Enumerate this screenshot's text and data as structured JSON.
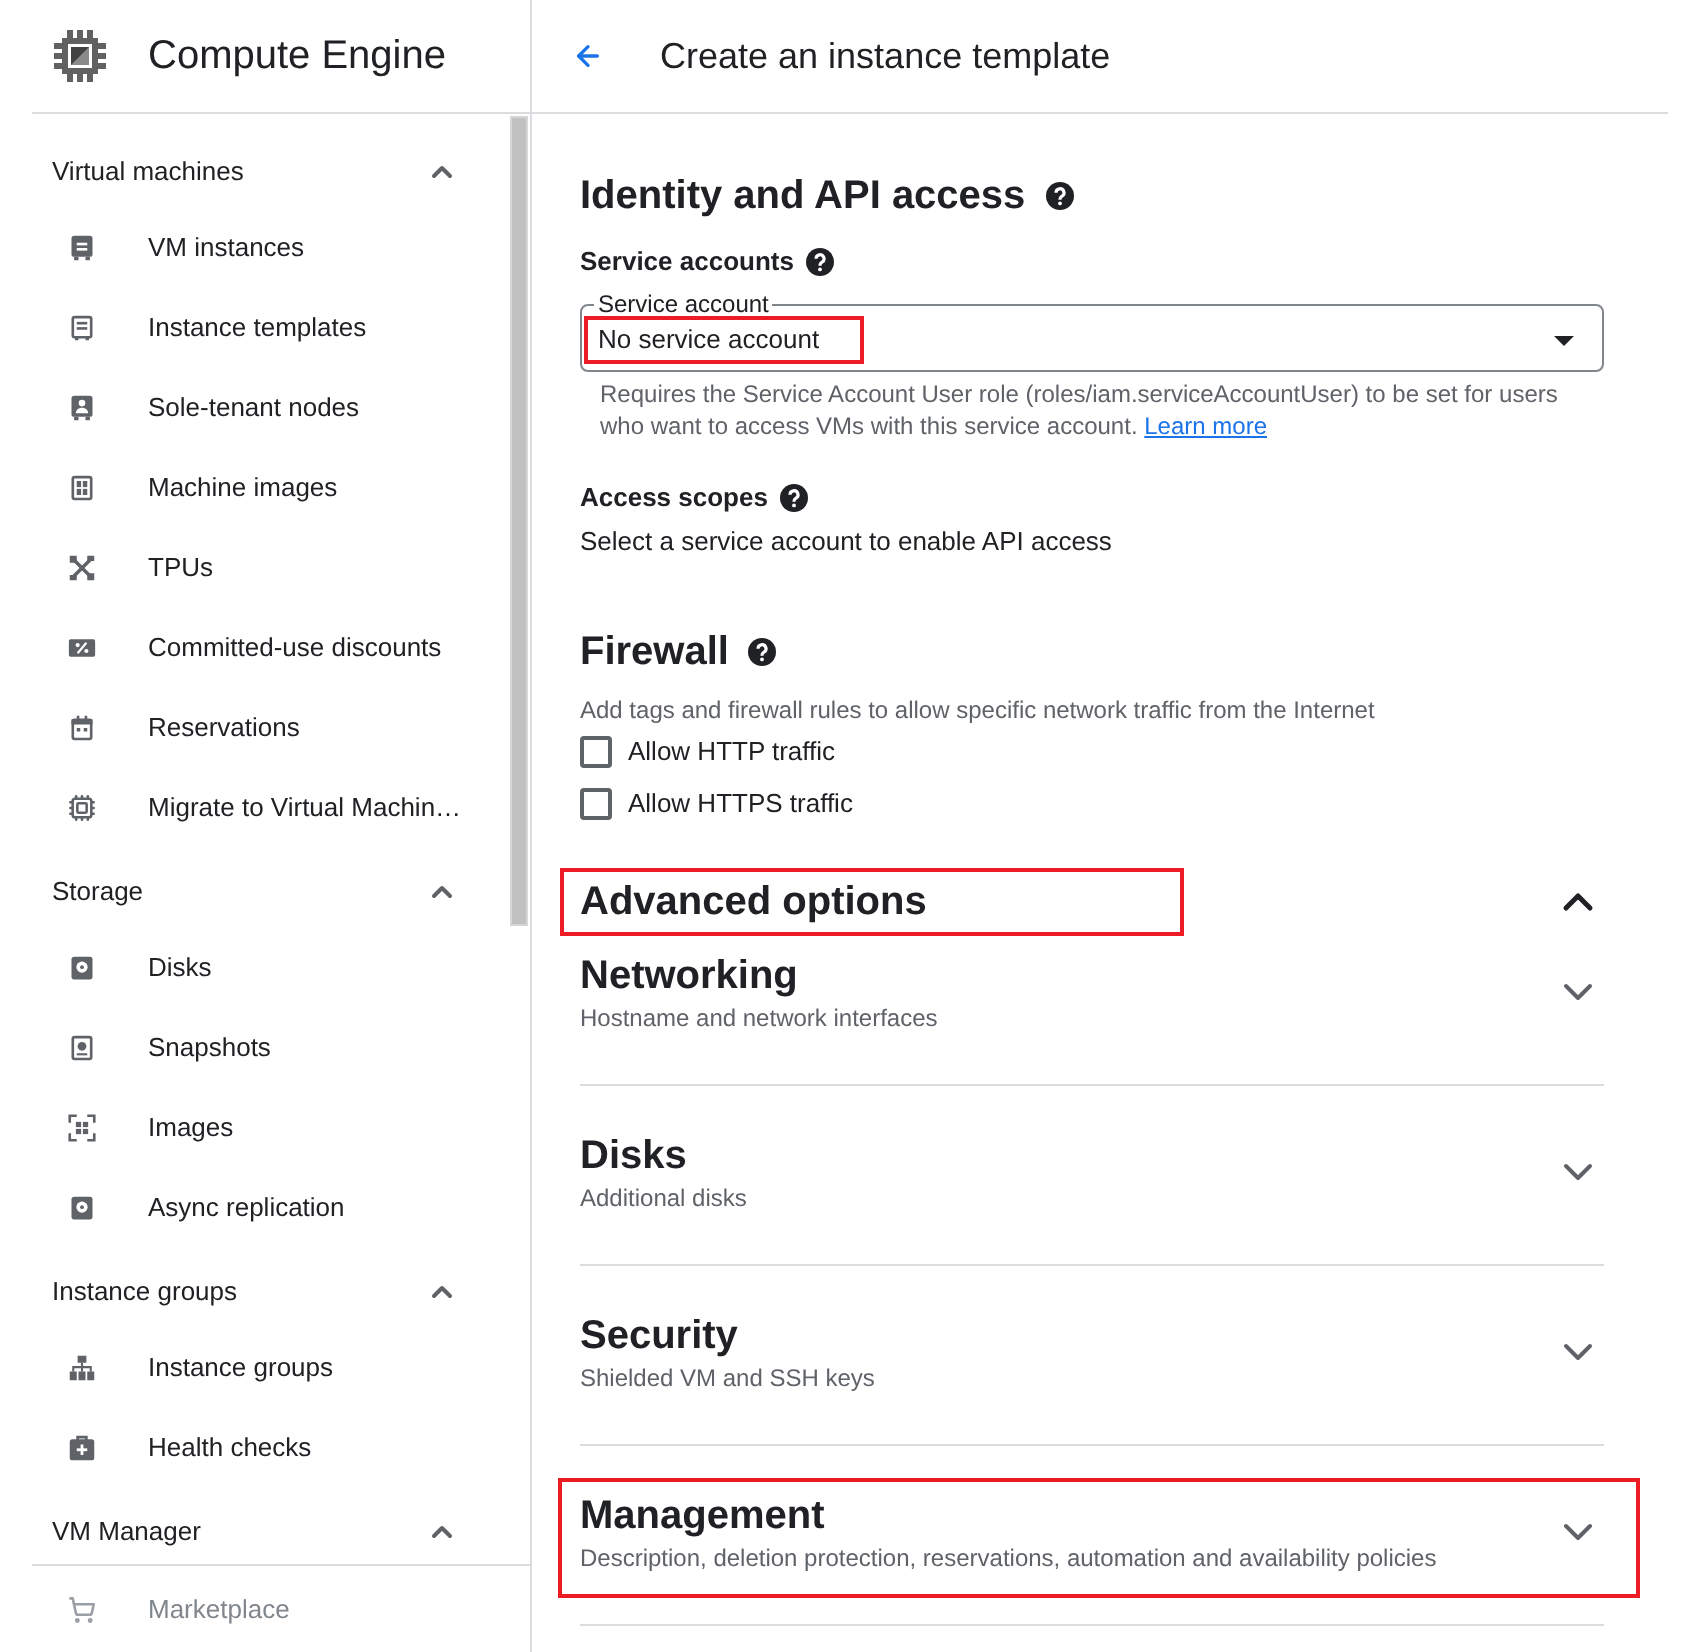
{
  "sidebar": {
    "title": "Compute Engine",
    "groups": [
      {
        "label": "Virtual machines",
        "expanded": true,
        "items": [
          {
            "label": "VM instances",
            "disabled": false
          },
          {
            "label": "Instance templates",
            "disabled": false
          },
          {
            "label": "Sole-tenant nodes",
            "disabled": false
          },
          {
            "label": "Machine images",
            "disabled": false
          },
          {
            "label": "TPUs",
            "disabled": false
          },
          {
            "label": "Committed-use discounts",
            "disabled": false
          },
          {
            "label": "Reservations",
            "disabled": false
          },
          {
            "label": "Migrate to Virtual Machin…",
            "disabled": false
          }
        ]
      },
      {
        "label": "Storage",
        "expanded": true,
        "items": [
          {
            "label": "Disks",
            "disabled": false
          },
          {
            "label": "Snapshots",
            "disabled": false
          },
          {
            "label": "Images",
            "disabled": false
          },
          {
            "label": "Async replication",
            "disabled": false
          }
        ]
      },
      {
        "label": "Instance groups",
        "expanded": true,
        "items": [
          {
            "label": "Instance groups",
            "disabled": false
          },
          {
            "label": "Health checks",
            "disabled": false
          }
        ]
      },
      {
        "label": "VM Manager",
        "expanded": true,
        "items": [
          {
            "label": "Marketplace",
            "disabled": true
          }
        ]
      }
    ]
  },
  "header": {
    "title": "Create an instance template"
  },
  "identity": {
    "title": "Identity and API access",
    "service_accounts": {
      "label": "Service accounts",
      "select": {
        "label": "Service account",
        "value": "No service account",
        "highlighted": true
      },
      "hint": "Requires the Service Account User role (roles/iam.serviceAccountUser) to be set for users who want to access VMs with this service account.",
      "link": "Learn more"
    },
    "access_scopes": {
      "label": "Access scopes",
      "text": "Select a service account to enable API access"
    }
  },
  "firewall": {
    "title": "Firewall",
    "description": "Add tags and firewall rules to allow specific network traffic from the Internet",
    "options": [
      {
        "label": "Allow HTTP traffic",
        "checked": false
      },
      {
        "label": "Allow HTTPS traffic",
        "checked": false
      }
    ]
  },
  "advanced": {
    "title": "Advanced options",
    "expanded": true,
    "highlighted": true,
    "sections": [
      {
        "title": "Networking",
        "subtitle": "Hostname and network interfaces",
        "expanded": false,
        "highlighted": false
      },
      {
        "title": "Disks",
        "subtitle": "Additional disks",
        "expanded": false,
        "highlighted": false
      },
      {
        "title": "Security",
        "subtitle": "Shielded VM and SSH keys",
        "expanded": false,
        "highlighted": false
      },
      {
        "title": "Management",
        "subtitle": "Description, deletion protection, reservations, automation and availability policies",
        "expanded": false,
        "highlighted": true
      }
    ]
  }
}
